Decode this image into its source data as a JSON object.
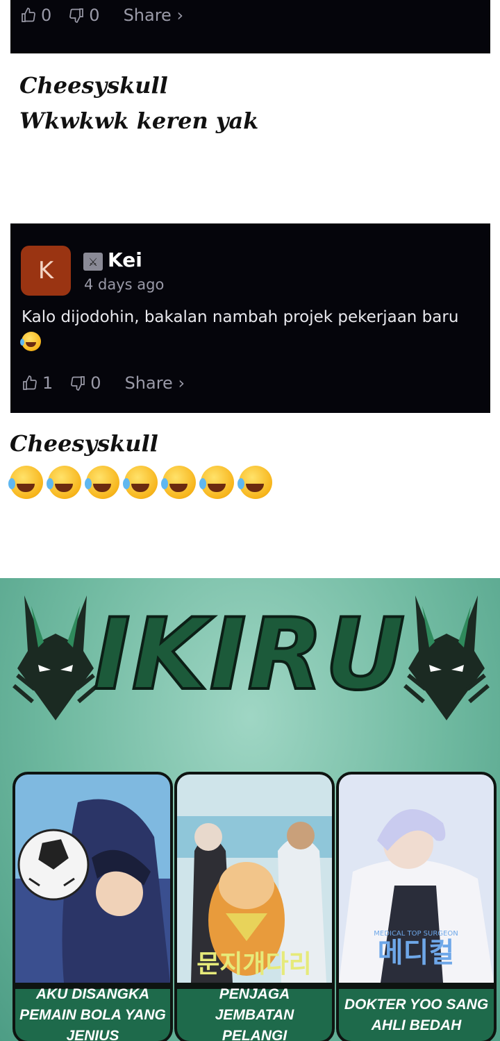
{
  "comment_top": {
    "likes": "0",
    "dislikes": "0",
    "share_label": "Share ›"
  },
  "reply_one": {
    "author": "Cheesyskull",
    "text": "Wkwkwk keren yak"
  },
  "comment_kei": {
    "avatar_letter": "K",
    "avatar_color": "#9a3412",
    "username": "Kei",
    "timestamp": "4 days ago",
    "body": "Kalo dijodohin, bakalan nambah projek pekerjaan baru",
    "likes": "1",
    "dislikes": "0",
    "share_label": "Share ›"
  },
  "reply_two": {
    "author": "Cheesyskull",
    "emoji_icon": "rolling-on-floor-laughing-icon",
    "emoji_count": 7
  },
  "banner": {
    "logo": "IKIRU",
    "cards": [
      {
        "title": "AKU DISANGKA PEMAIN BOLA YANG JENIUS"
      },
      {
        "title": "PENJAGA JEMBATAN PELANGI"
      },
      {
        "title": "DOKTER YOO SANG AHLI BEDAH"
      }
    ],
    "accent_color": "#1e6a4b"
  }
}
